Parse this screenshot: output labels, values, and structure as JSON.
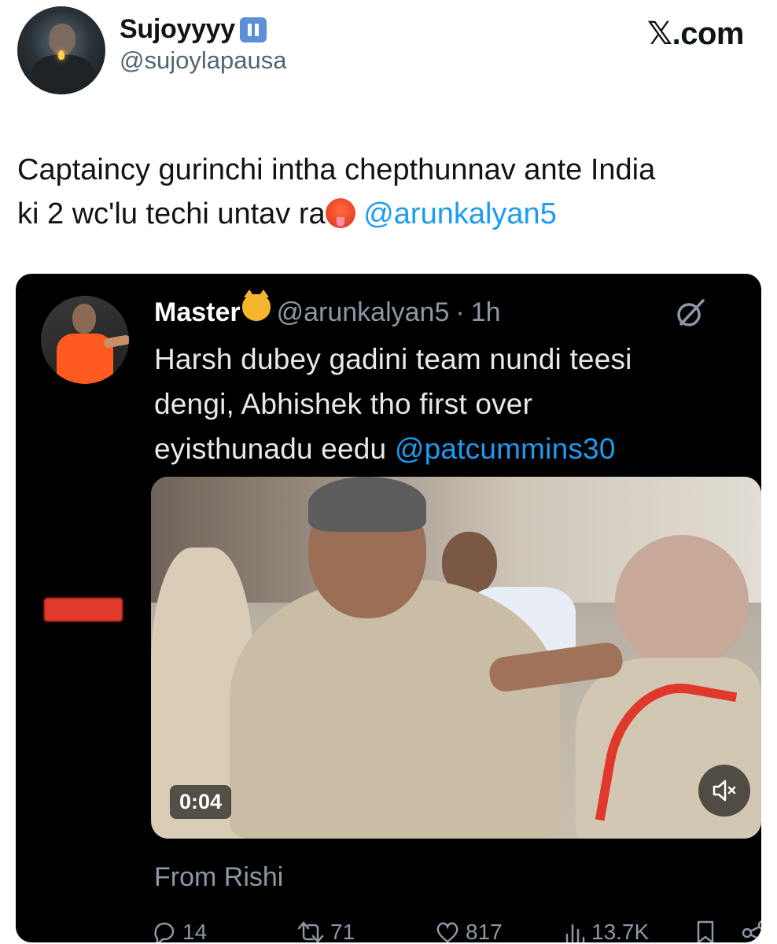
{
  "author": {
    "display_name": "Sujoyyyy",
    "handle": "@sujoylapausa",
    "badge_icon": "pause-icon",
    "avatar_icon": "avatar"
  },
  "source_label": "𝕏.com",
  "tweet": {
    "text_line1": "Captaincy gurinchi intha chepthunnav ante India",
    "text_line2": "ki 2 wc'lu techi untav ra",
    "emoji": "hot-face-emoji",
    "mention": "@arunkalyan5"
  },
  "quoted": {
    "display_name": "Master",
    "name_emoji": "cat-tears-of-joy-emoji",
    "handle": "@arunkalyan5",
    "separator": "·",
    "time": "1h",
    "text_line1": "Harsh dubey gadini team nundi teesi",
    "text_line2": "dengi, Abhishek tho first over",
    "text_line3_prefix": "eyisthunadu eedu ",
    "text_mention": "@patcummins30",
    "video": {
      "duration": "0:04",
      "mute_icon": "speaker-muted-icon"
    },
    "from_label": "From Rishi",
    "stats": {
      "replies": "14",
      "reposts": "71",
      "likes": "817",
      "views": "13.7K"
    }
  },
  "colors": {
    "link": "#1d9bf0",
    "card_bg": "#000000",
    "muted_text": "#8b98a5",
    "handle_gray": "#536471",
    "badge_blue": "#5b8fd6"
  }
}
